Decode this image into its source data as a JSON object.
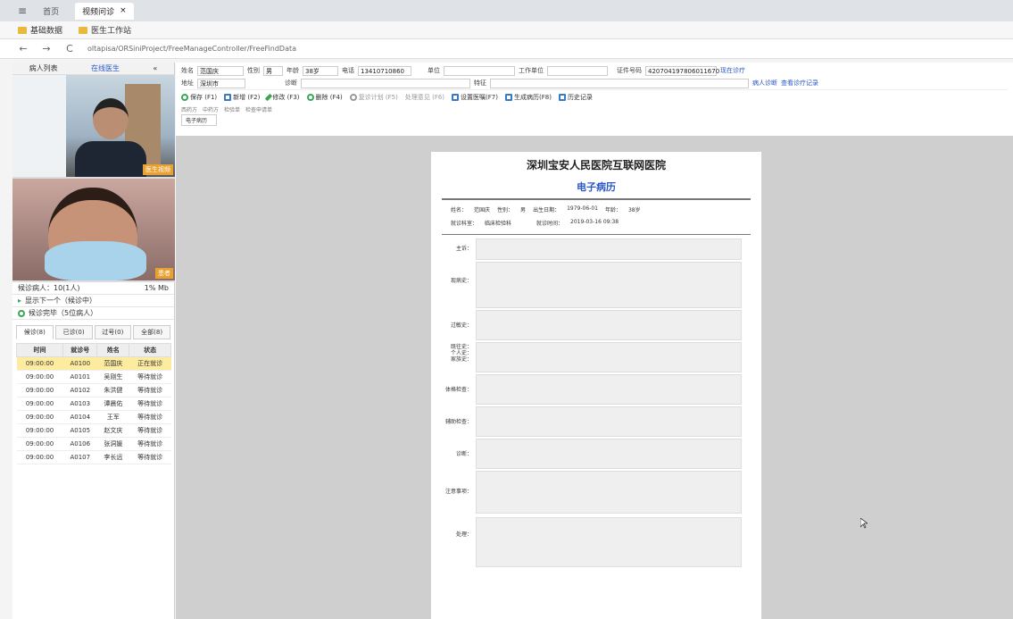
{
  "browser": {
    "tabs": [
      "首页",
      "视频问诊"
    ],
    "bookmarks": [
      "基础数据",
      "医生工作站"
    ],
    "url": "oltapisa/ORSiniProject/FreeManageController/FreeFindData"
  },
  "left": {
    "header": {
      "col1": "病人列表",
      "col2": "在线医生",
      "col3": "«"
    },
    "video_labels": [
      "医生视频",
      "患者"
    ],
    "patient_row": {
      "label": "候诊病人：10(1人)",
      "right": "1% Mb"
    },
    "status1": "显示下一个（候诊中）",
    "status2": "候诊完毕（5位病人）",
    "tabs": [
      "候诊(8)",
      "已诊(0)",
      "过号(0)",
      "全部(8)"
    ],
    "table_headers": [
      "时间",
      "就诊号",
      "姓名",
      "状态"
    ],
    "rows": [
      [
        "09:00:00",
        "A0100",
        "范国庆",
        "正在就诊"
      ],
      [
        "09:00:00",
        "A0101",
        "吴刚生",
        "等待就诊"
      ],
      [
        "09:00:00",
        "A0102",
        "朱洪健",
        "等待就诊"
      ],
      [
        "09:00:00",
        "A0103",
        "谭晨佑",
        "等待就诊"
      ],
      [
        "09:00:00",
        "A0104",
        "王军",
        "等待就诊"
      ],
      [
        "09:00:00",
        "A0105",
        "赵文庆",
        "等待就诊"
      ],
      [
        "09:00:00",
        "A0106",
        "张洞媛",
        "等待就诊"
      ],
      [
        "09:00:00",
        "A0107",
        "李长远",
        "等待就诊"
      ]
    ]
  },
  "form": {
    "name_label": "姓名",
    "name": "范国庆",
    "sex_label": "性别",
    "sex": "男",
    "age_label": "年龄",
    "age": "38岁",
    "phone_label": "电话",
    "phone": "13410710860",
    "company_label": "单位",
    "work_label": "工作单位",
    "id_label": "证件号码",
    "id_value": "420704197806011670",
    "link1": "现在诊疗",
    "addr_label": "地址",
    "addr": "深圳市",
    "diag_label": "诊断",
    "feature_label": "特征",
    "link2": "病人诊断",
    "link3": "查看诊疗记录",
    "toolbar": [
      "保存 (F1)",
      "新增 (F2)",
      "修改 (F3)",
      "删除 (F4)",
      "复诊计划 (F5)",
      "处理意见 (F6)",
      "设置医嘱(F7)",
      "生成病历(F8)",
      "历史记录"
    ],
    "subtabs": [
      "西药方",
      "中药方",
      "检验单",
      "检查申请单"
    ],
    "page_tab": "电子病历"
  },
  "document": {
    "title": "深圳宝安人民医院互联网医院",
    "subtitle": "电子病历",
    "info1": [
      "姓名：",
      "范国庆",
      "性别：",
      "男",
      "出生日期：",
      "1979-06-01",
      "年龄：",
      "38岁"
    ],
    "info2": [
      "就诊科室：",
      "临床检验科",
      "就诊时间：",
      "2019-03-16 09:38"
    ],
    "sections": [
      "主诉：",
      "现病史：",
      "过敏史：",
      "既往史：\n个人史：\n家族史：",
      "体格检查：",
      "辅助检查：",
      "诊断：",
      "注意事项：",
      "处理："
    ]
  },
  "colors": {
    "accent": "#2a57c8",
    "selected_row": "#fdeba0",
    "video_badge": "#e8a030"
  }
}
